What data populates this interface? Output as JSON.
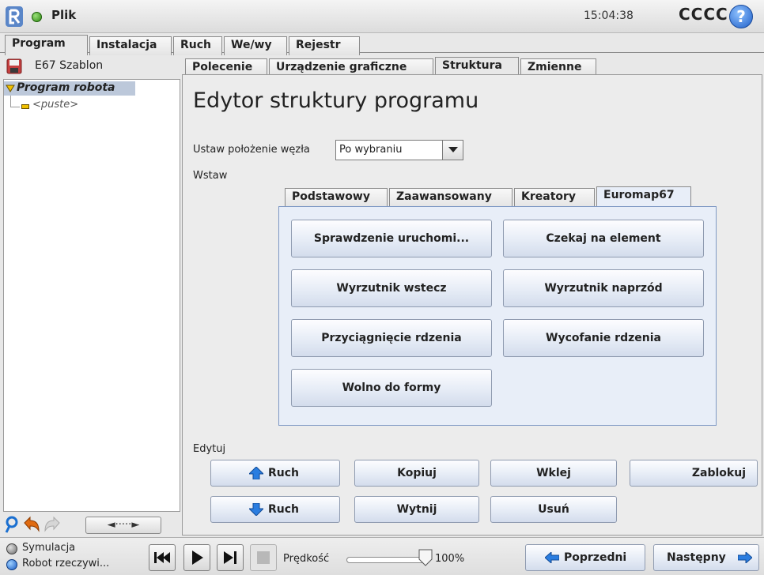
{
  "header": {
    "file_label": "Plik",
    "clock": "15:04:38",
    "robot_name": "CCCC",
    "help_glyph": "?"
  },
  "main_tabs": [
    "Program",
    "Instalacja",
    "Ruch",
    "We/wy",
    "Rejestr"
  ],
  "left": {
    "program_name": "E67 Szablon",
    "tree_root": "Program robota",
    "tree_child": "<puste>",
    "nav_arrow": "◄·····►"
  },
  "sub_tabs": [
    "Polecenie",
    "Urządzenie graficzne",
    "Struktura",
    "Zmienne"
  ],
  "editor": {
    "title": "Edytor struktury programu",
    "position_label": "Ustaw położenie węzła",
    "position_value": "Po wybraniu",
    "insert_label": "Wstaw",
    "insert_tabs": [
      "Podstawowy",
      "Zaawansowany",
      "Kreatory",
      "Euromap67"
    ],
    "insert_buttons": [
      "Sprawdzenie uruchomi...",
      "Czekaj na element",
      "Wyrzutnik wstecz",
      "Wyrzutnik naprzód",
      "Przyciągnięcie rdzenia",
      "Wycofanie rdzenia",
      "Wolno do formy"
    ],
    "edit_label": "Edytuj",
    "edit_buttons": {
      "move_up": "Ruch",
      "copy": "Kopiuj",
      "paste": "Wklej",
      "lock": "Zablokuj",
      "move_down": "Ruch",
      "cut": "Wytnij",
      "delete": "Usuń"
    }
  },
  "bottom": {
    "simulation": "Symulacja",
    "real_robot": "Robot rzeczywi...",
    "speed_label": "Prędkość",
    "speed_value": "100%",
    "speed_fraction": 1.0,
    "prev": "Poprzedni",
    "next": "Następny"
  },
  "colors": {
    "accent_blue": "#2a7de0",
    "status_green": "#3aa017",
    "tree_selected": "#bcc8da"
  },
  "icons": [
    "logo-icon",
    "status-dot-icon",
    "help-icon",
    "save-icon",
    "search-icon",
    "undo-icon",
    "redo-icon",
    "arrow-up-icon",
    "arrow-down-icon",
    "arrow-left-icon",
    "arrow-right-icon",
    "rewind-icon",
    "play-icon",
    "step-icon",
    "stop-icon"
  ]
}
